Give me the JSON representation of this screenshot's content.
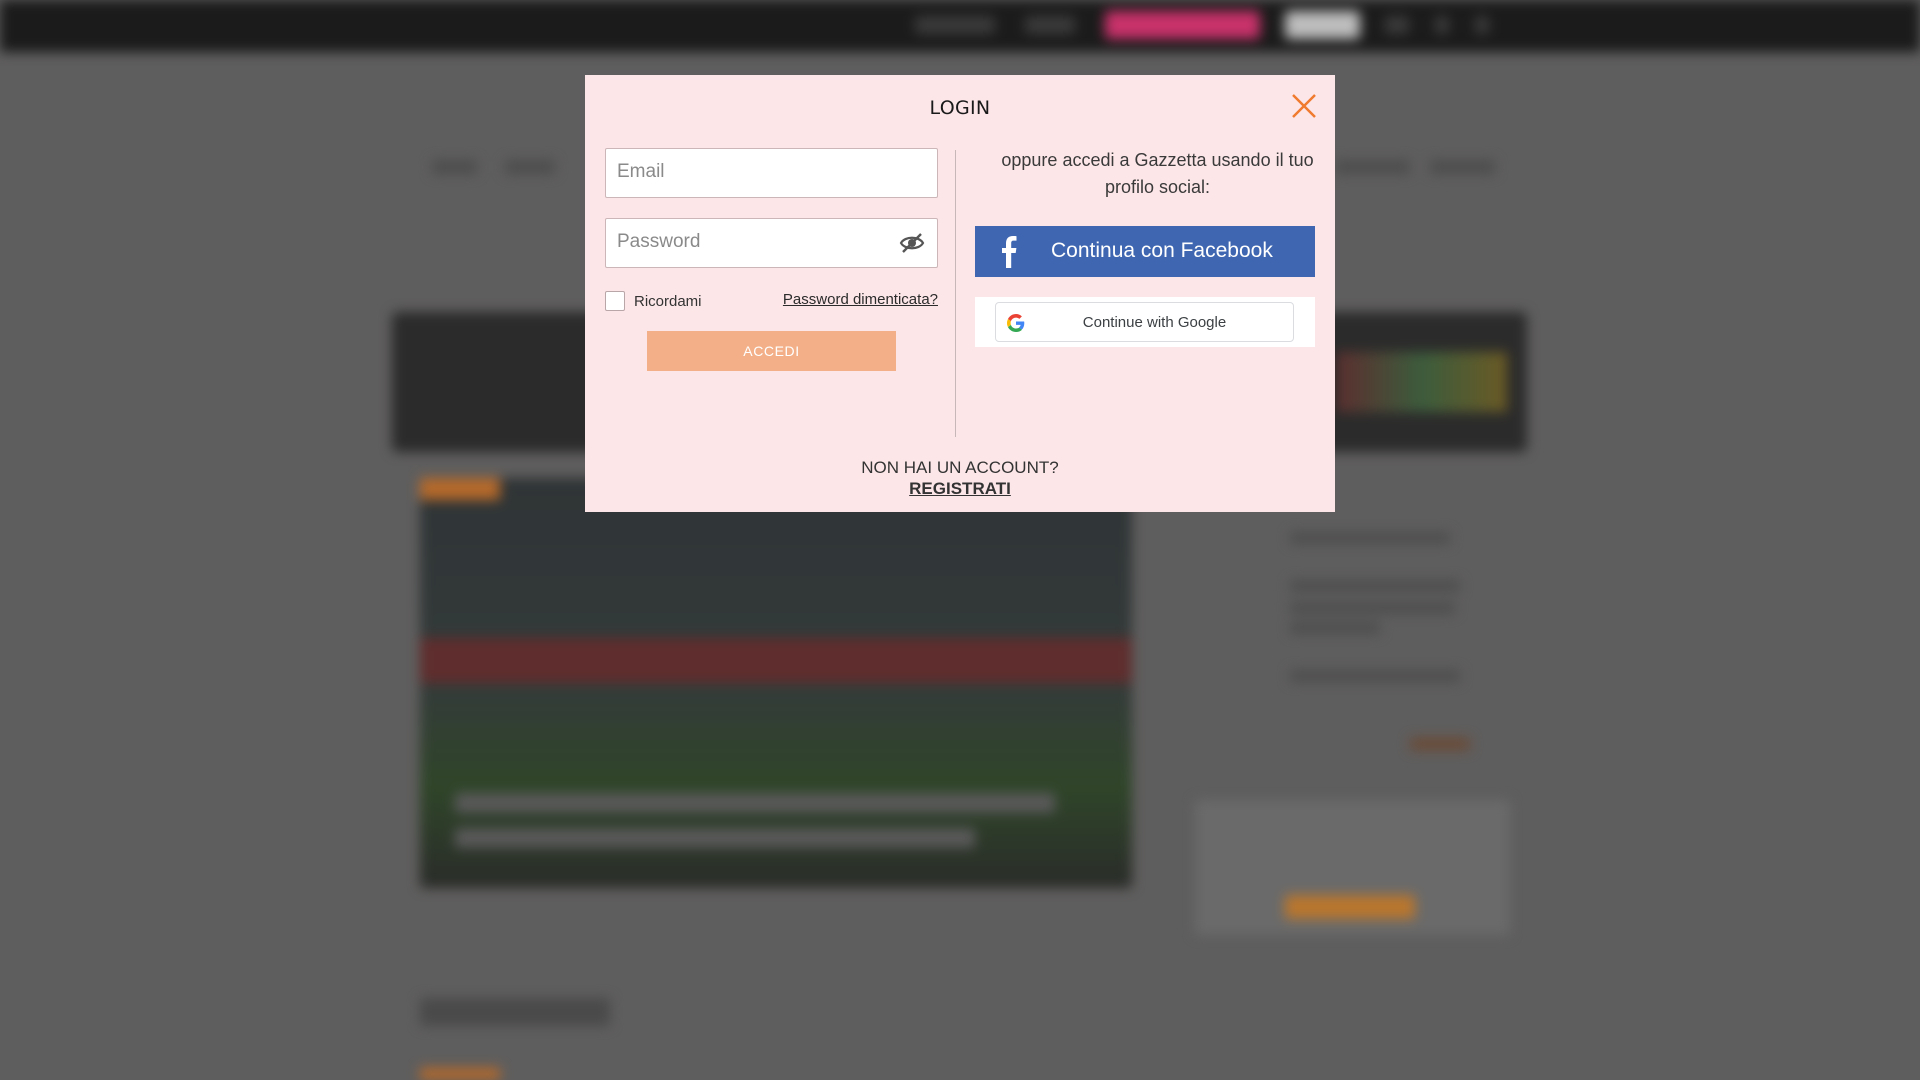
{
  "modal": {
    "title": "LOGIN",
    "email_placeholder": "Email",
    "password_placeholder": "Password",
    "remember_label": "Ricordami",
    "forgot_label": "Password dimenticata?",
    "submit_label": "ACCEDI",
    "social_text": "oppure accedi a Gazzetta usando il tuo profilo social:",
    "facebook_label": "Continua con Facebook",
    "google_label": "Continue with Google",
    "no_account": "NON HAI UN ACCOUNT?",
    "register": "REGISTRATI"
  },
  "colors": {
    "modal_bg": "#fde6e8",
    "facebook": "#3f67b1",
    "accent_close": "#f07a2e",
    "submit_bg": "#f3b088",
    "overlay": "#5f5e5e"
  }
}
